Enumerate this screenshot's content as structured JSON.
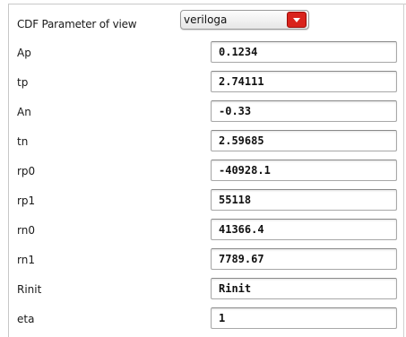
{
  "header": {
    "label": "CDF Parameter of view",
    "view_select": {
      "value": "veriloga",
      "icon": "chevron-down-icon",
      "button_color": "#d9231c"
    }
  },
  "params": [
    {
      "name": "Ap",
      "value": "0.1234"
    },
    {
      "name": "tp",
      "value": "2.74111"
    },
    {
      "name": "An",
      "value": "-0.33"
    },
    {
      "name": "tn",
      "value": "2.59685"
    },
    {
      "name": "rp0",
      "value": "-40928.1"
    },
    {
      "name": "rp1",
      "value": "55118"
    },
    {
      "name": "rn0",
      "value": "41366.4"
    },
    {
      "name": "rn1",
      "value": "7789.67"
    },
    {
      "name": "Rinit",
      "value": "Rinit"
    },
    {
      "name": "eta",
      "value": "1"
    }
  ]
}
